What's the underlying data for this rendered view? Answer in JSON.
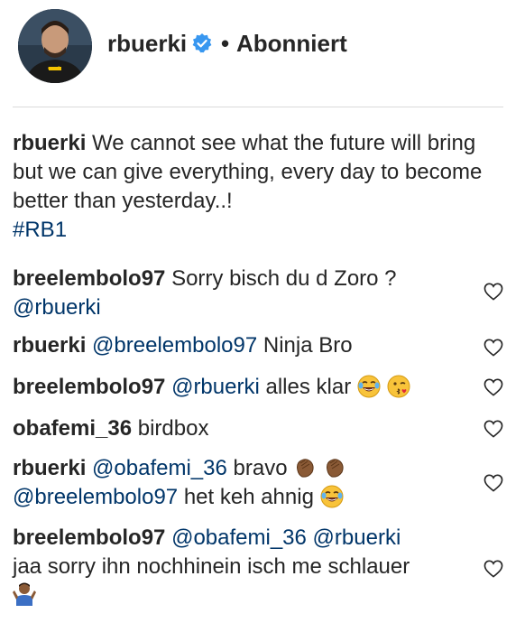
{
  "header": {
    "username": "rbuerki",
    "separator": "•",
    "follow_status": "Abonniert"
  },
  "caption": {
    "username": "rbuerki",
    "text": "We cannot see what the future will bring but we can give everything, every day to become better than yesterday..!",
    "hashtag": "#RB1"
  },
  "comments": [
    {
      "username": "breelembolo97",
      "text": "Sorry bisch du d Zoro ?",
      "mention": "@rbuerki"
    },
    {
      "username": "rbuerki",
      "mention": "@breelembolo97",
      "text": "Ninja Bro"
    },
    {
      "username": "breelembolo97",
      "mention": "@rbuerki",
      "text": "alles klar"
    },
    {
      "username": "obafemi_36",
      "text": "birdbox"
    },
    {
      "username": "rbuerki",
      "mention": "@obafemi_36",
      "text": "bravo",
      "mention2": "@breelembolo97",
      "text2": "het keh ahnig"
    },
    {
      "username": "breelembolo97",
      "mention": "@obafemi_36",
      "mention2": "@rbuerki",
      "text": "jaa sorry ihn nochhinein isch me schlauer"
    }
  ],
  "icons": {
    "verified": "verified-badge-icon",
    "heart": "heart-outline-icon",
    "emoji_laugh": "tears-of-joy-emoji",
    "emoji_wink": "kissing-wink-emoji",
    "emoji_clap": "clapping-hands-emoji",
    "emoji_shrug": "person-shrugging-emoji"
  },
  "colors": {
    "text": "#262626",
    "link": "#003569",
    "verified": "#3897f0",
    "divider": "#dbdbdb"
  }
}
